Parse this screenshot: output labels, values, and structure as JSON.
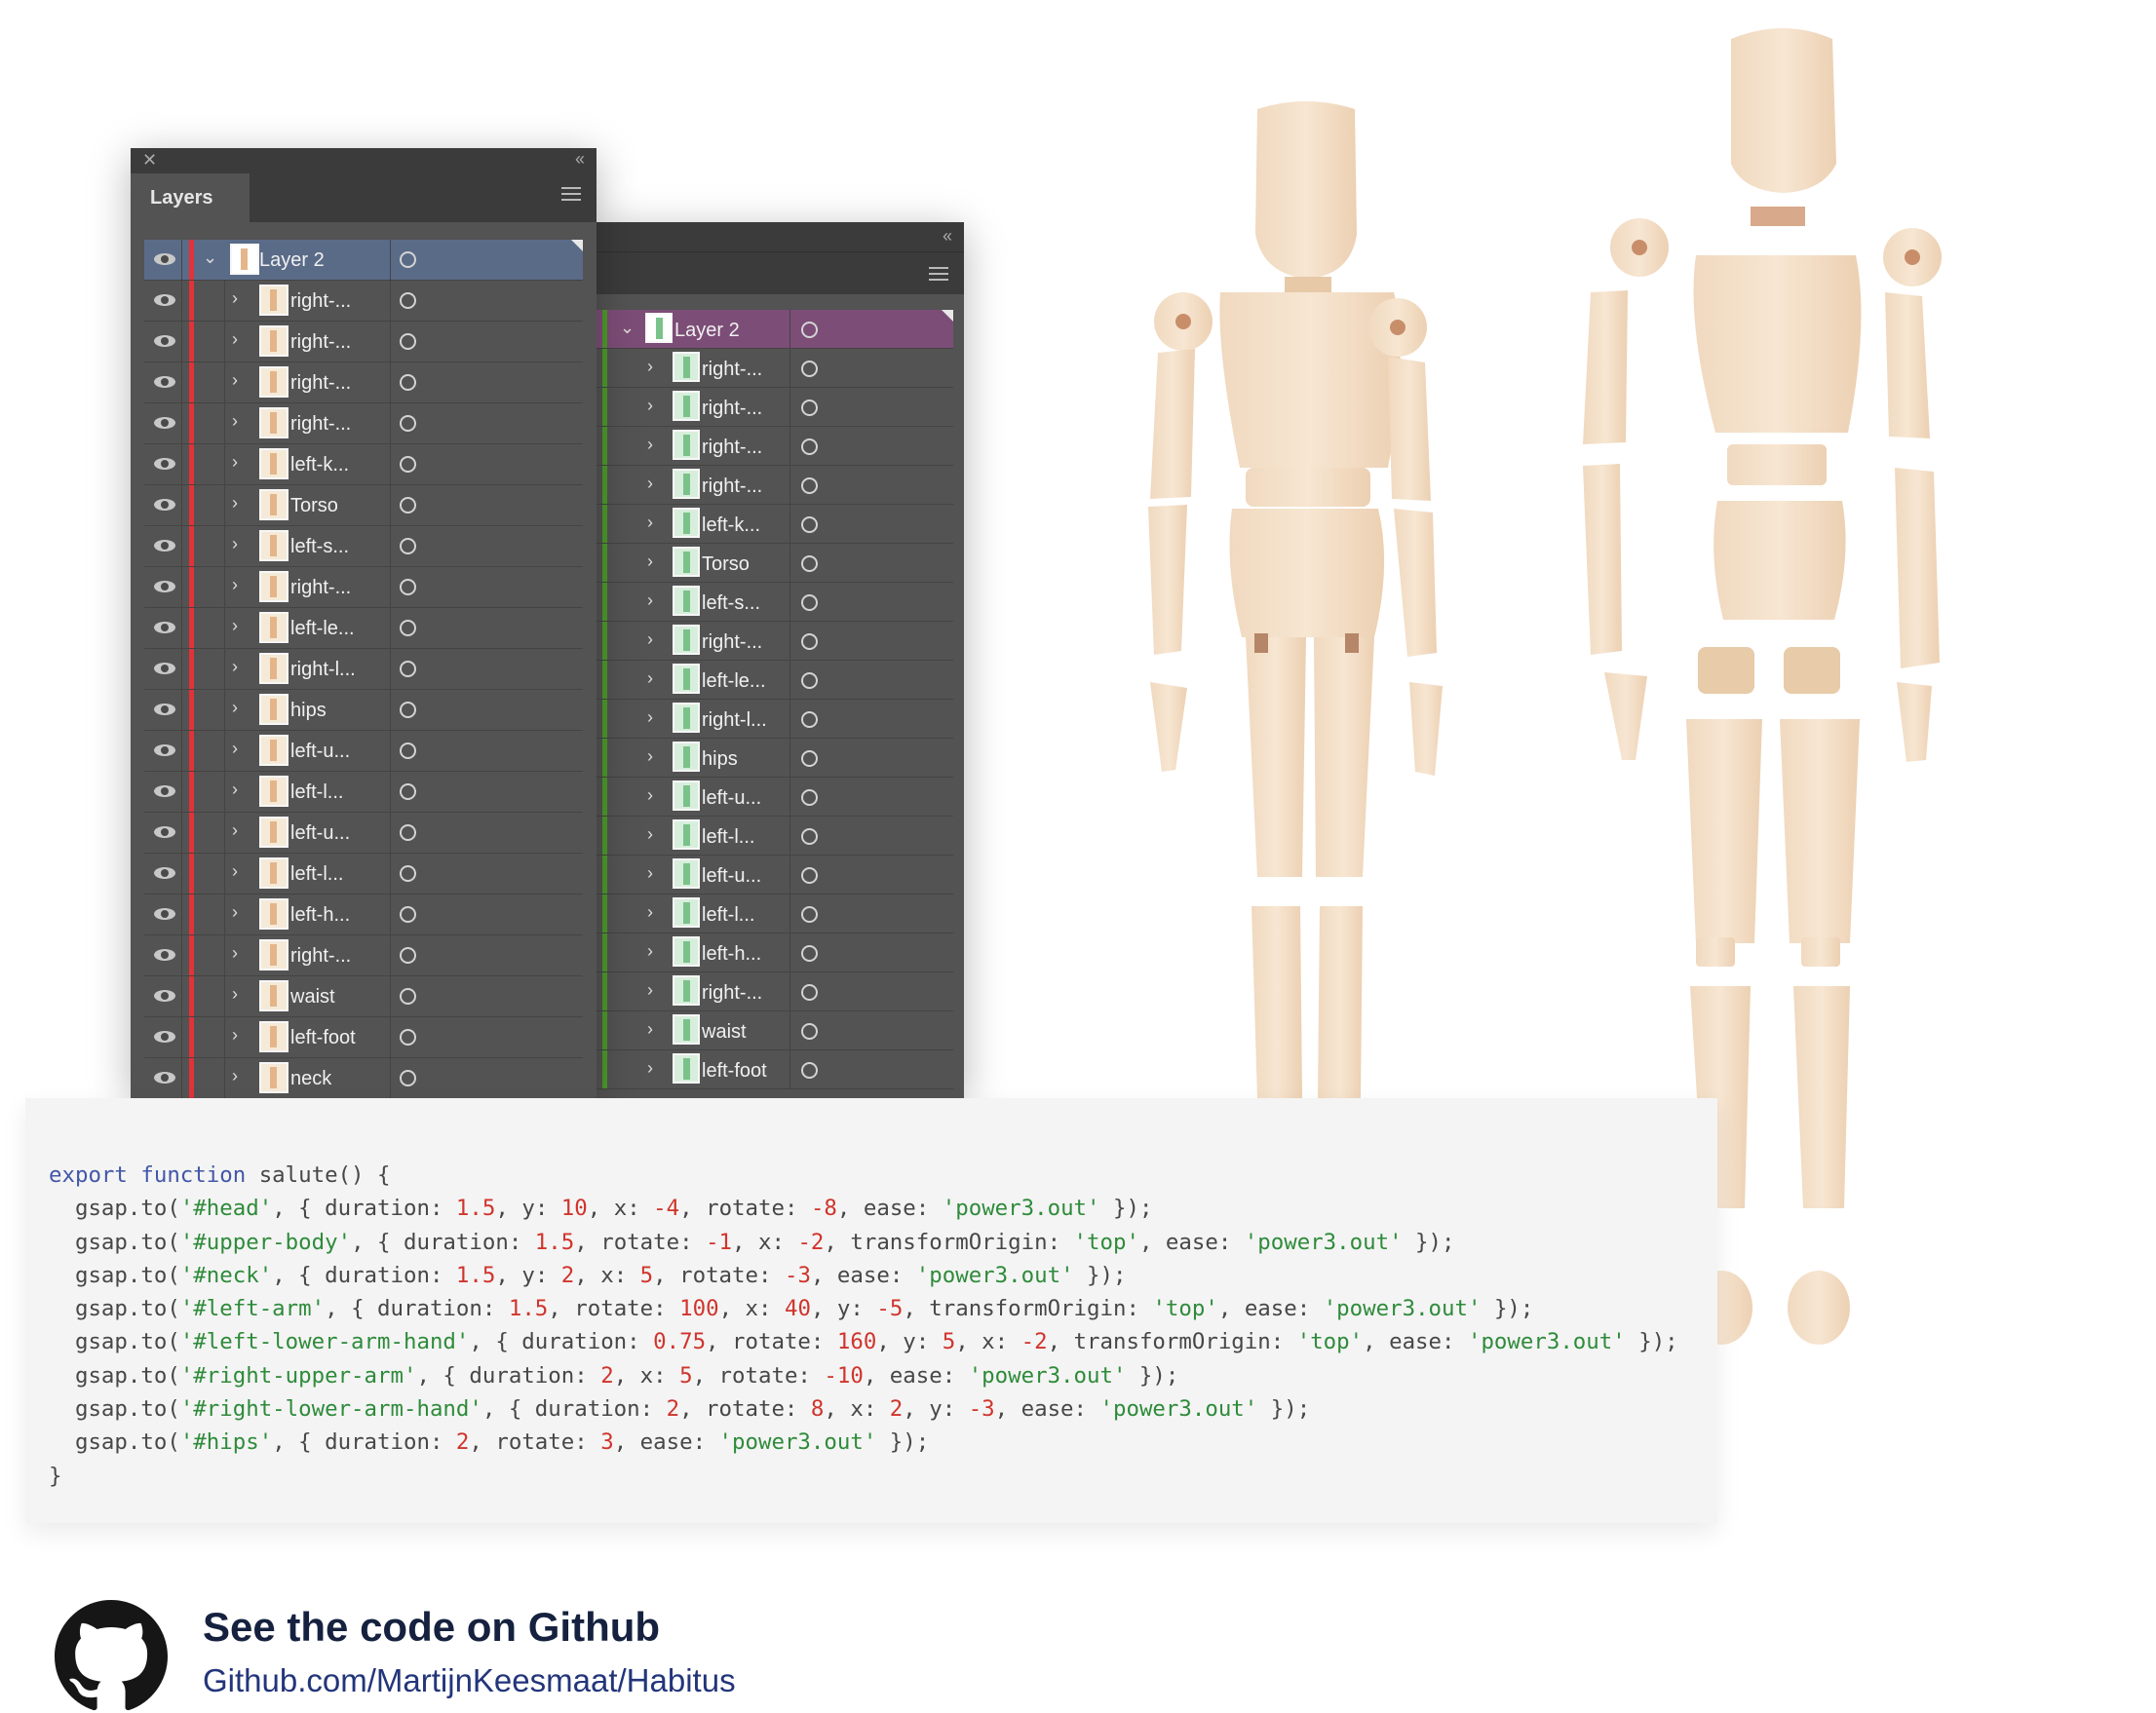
{
  "panel1": {
    "tab_label": "Layers",
    "head_layer": "Layer 2",
    "colors": {
      "accent": "#e2323a",
      "selected_row": "#5a6b88"
    },
    "rows": [
      "right-...",
      "right-...",
      "right-...",
      "right-...",
      "left-k...",
      "Torso",
      "left-s...",
      "right-...",
      "left-le...",
      "right-l...",
      "hips",
      "left-u...",
      "left-l...",
      "left-u...",
      "left-l...",
      "left-h...",
      "right-...",
      "waist",
      "left-foot",
      "neck"
    ]
  },
  "panel2": {
    "head_layer": "Layer 2",
    "colors": {
      "accent": "#4c9a2a",
      "selected_row": "#7c4d77"
    },
    "rows": [
      "right-...",
      "right-...",
      "right-...",
      "right-...",
      "left-k...",
      "Torso",
      "left-s...",
      "right-...",
      "left-le...",
      "right-l...",
      "hips",
      "left-u...",
      "left-l...",
      "left-u...",
      "left-l...",
      "left-h...",
      "right-...",
      "waist",
      "left-foot"
    ]
  },
  "code": {
    "lines": [
      [
        [
          "kw",
          "export function"
        ],
        [
          "t",
          " salute() {"
        ]
      ],
      [
        [
          "t",
          "  gsap.to("
        ],
        [
          "str",
          "'#head'"
        ],
        [
          "t",
          ", { duration: "
        ],
        [
          "num",
          "1.5"
        ],
        [
          "t",
          ", y: "
        ],
        [
          "num",
          "10"
        ],
        [
          "t",
          ", x: "
        ],
        [
          "num",
          "-4"
        ],
        [
          "t",
          ", rotate: "
        ],
        [
          "num",
          "-8"
        ],
        [
          "t",
          ", ease: "
        ],
        [
          "str",
          "'power3.out'"
        ],
        [
          "t",
          " });"
        ]
      ],
      [
        [
          "t",
          "  gsap.to("
        ],
        [
          "str",
          "'#upper-body'"
        ],
        [
          "t",
          ", { duration: "
        ],
        [
          "num",
          "1.5"
        ],
        [
          "t",
          ", rotate: "
        ],
        [
          "num",
          "-1"
        ],
        [
          "t",
          ", x: "
        ],
        [
          "num",
          "-2"
        ],
        [
          "t",
          ", transformOrigin: "
        ],
        [
          "str",
          "'top'"
        ],
        [
          "t",
          ", ease: "
        ],
        [
          "str",
          "'power3.out'"
        ],
        [
          "t",
          " });"
        ]
      ],
      [
        [
          "t",
          "  gsap.to("
        ],
        [
          "str",
          "'#neck'"
        ],
        [
          "t",
          ", { duration: "
        ],
        [
          "num",
          "1.5"
        ],
        [
          "t",
          ", y: "
        ],
        [
          "num",
          "2"
        ],
        [
          "t",
          ", x: "
        ],
        [
          "num",
          "5"
        ],
        [
          "t",
          ", rotate: "
        ],
        [
          "num",
          "-3"
        ],
        [
          "t",
          ", ease: "
        ],
        [
          "str",
          "'power3.out'"
        ],
        [
          "t",
          " });"
        ]
      ],
      [
        [
          "t",
          "  gsap.to("
        ],
        [
          "str",
          "'#left-arm'"
        ],
        [
          "t",
          ", { duration: "
        ],
        [
          "num",
          "1.5"
        ],
        [
          "t",
          ", rotate: "
        ],
        [
          "num",
          "100"
        ],
        [
          "t",
          ", x: "
        ],
        [
          "num",
          "40"
        ],
        [
          "t",
          ", y: "
        ],
        [
          "num",
          "-5"
        ],
        [
          "t",
          ", transformOrigin: "
        ],
        [
          "str",
          "'top'"
        ],
        [
          "t",
          ", ease: "
        ],
        [
          "str",
          "'power3.out'"
        ],
        [
          "t",
          " });"
        ]
      ],
      [
        [
          "t",
          "  gsap.to("
        ],
        [
          "str",
          "'#left-lower-arm-hand'"
        ],
        [
          "t",
          ", { duration: "
        ],
        [
          "num",
          "0.75"
        ],
        [
          "t",
          ", rotate: "
        ],
        [
          "num",
          "160"
        ],
        [
          "t",
          ", y: "
        ],
        [
          "num",
          "5"
        ],
        [
          "t",
          ", x: "
        ],
        [
          "num",
          "-2"
        ],
        [
          "t",
          ", transformOrigin: "
        ],
        [
          "str",
          "'top'"
        ],
        [
          "t",
          ", ease: "
        ],
        [
          "str",
          "'power3.out'"
        ],
        [
          "t",
          " });"
        ]
      ],
      [
        [
          "t",
          "  gsap.to("
        ],
        [
          "str",
          "'#right-upper-arm'"
        ],
        [
          "t",
          ", { duration: "
        ],
        [
          "num",
          "2"
        ],
        [
          "t",
          ", x: "
        ],
        [
          "num",
          "5"
        ],
        [
          "t",
          ", rotate: "
        ],
        [
          "num",
          "-10"
        ],
        [
          "t",
          ", ease: "
        ],
        [
          "str",
          "'power3.out'"
        ],
        [
          "t",
          " });"
        ]
      ],
      [
        [
          "t",
          "  gsap.to("
        ],
        [
          "str",
          "'#right-lower-arm-hand'"
        ],
        [
          "t",
          ", { duration: "
        ],
        [
          "num",
          "2"
        ],
        [
          "t",
          ", rotate: "
        ],
        [
          "num",
          "8"
        ],
        [
          "t",
          ", x: "
        ],
        [
          "num",
          "2"
        ],
        [
          "t",
          ", y: "
        ],
        [
          "num",
          "-3"
        ],
        [
          "t",
          ", ease: "
        ],
        [
          "str",
          "'power3.out'"
        ],
        [
          "t",
          " });"
        ]
      ],
      [
        [
          "t",
          "  gsap.to("
        ],
        [
          "str",
          "'#hips'"
        ],
        [
          "t",
          ", { duration: "
        ],
        [
          "num",
          "2"
        ],
        [
          "t",
          ", rotate: "
        ],
        [
          "num",
          "3"
        ],
        [
          "t",
          ", ease: "
        ],
        [
          "str",
          "'power3.out'"
        ],
        [
          "t",
          " });"
        ]
      ],
      [
        [
          "t",
          "}"
        ]
      ]
    ]
  },
  "footer": {
    "title": "See the code on Github",
    "link": "Github.com/MartijnKeesmaat/Habitus",
    "icon": "github-icon"
  }
}
